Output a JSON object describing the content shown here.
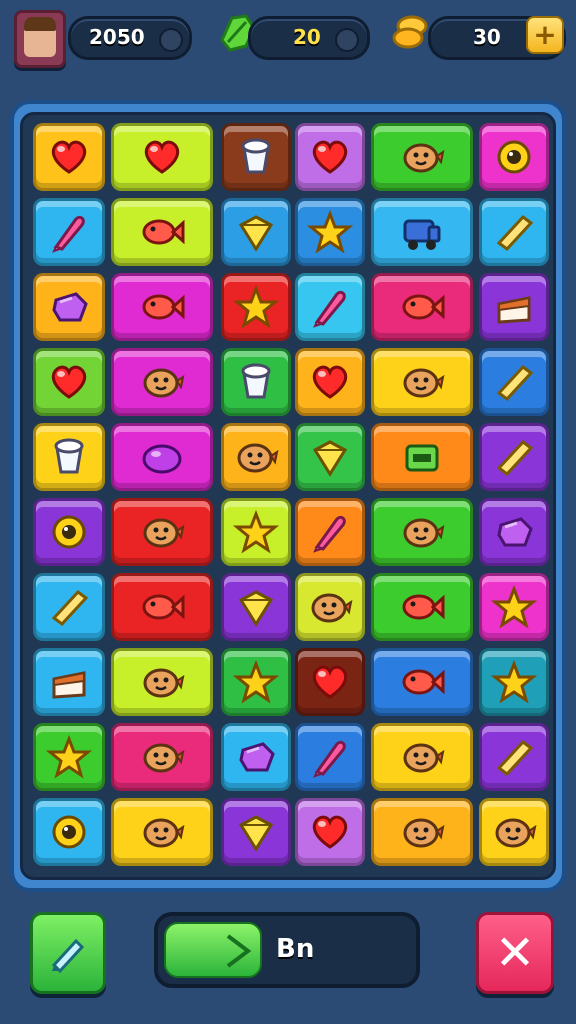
{
  "hud": {
    "lives_value": "2050",
    "leaves_value": "20",
    "coins_value": "30",
    "plus_label": "+"
  },
  "board": {
    "rows": [
      [
        {
          "color": "#ffc21a",
          "icon": "heart"
        },
        {
          "color": "#c8f02a",
          "icon": "heart"
        },
        {
          "color": "#8a3b1c",
          "icon": "cup"
        },
        {
          "color": "#c06ee8",
          "icon": "heart"
        },
        {
          "color": "#3dcc2e",
          "icon": "face"
        },
        {
          "color": "#ee33cc",
          "icon": "flower"
        }
      ],
      [
        {
          "color": "#2fb5ef",
          "icon": "drop"
        },
        {
          "color": "#c8f02a",
          "icon": "fish"
        },
        {
          "color": "#2b9ee6",
          "icon": "diamond"
        },
        {
          "color": "#2b8ee0",
          "icon": "star"
        },
        {
          "color": "#35b8f2",
          "icon": "truck"
        },
        {
          "color": "#2fb5ef",
          "icon": "stick"
        }
      ],
      [
        {
          "color": "#ffb31a",
          "icon": "gem"
        },
        {
          "color": "#e02ad2",
          "icon": "fish"
        },
        {
          "color": "#ea2424",
          "icon": "star"
        },
        {
          "color": "#36c6ef",
          "icon": "drop"
        },
        {
          "color": "#ea2a7a",
          "icon": "fish"
        },
        {
          "color": "#8a35d8",
          "icon": "cake"
        }
      ],
      [
        {
          "color": "#72d435",
          "icon": "heart"
        },
        {
          "color": "#e02ad2",
          "icon": "face"
        },
        {
          "color": "#2fbf45",
          "icon": "cup"
        },
        {
          "color": "#ffb31a",
          "icon": "heart"
        },
        {
          "color": "#ffd21a",
          "icon": "face"
        },
        {
          "color": "#2b7ee0",
          "icon": "stick"
        }
      ],
      [
        {
          "color": "#ffd21a",
          "icon": "cup"
        },
        {
          "color": "#e02ad2",
          "icon": "blob"
        },
        {
          "color": "#ffb31a",
          "icon": "face"
        },
        {
          "color": "#35c44a",
          "icon": "diamond"
        },
        {
          "color": "#ff8a1a",
          "icon": "box"
        },
        {
          "color": "#8a35d8",
          "icon": "stick"
        }
      ],
      [
        {
          "color": "#8a35d8",
          "icon": "flower"
        },
        {
          "color": "#ea2424",
          "icon": "face"
        },
        {
          "color": "#c8f02a",
          "icon": "star"
        },
        {
          "color": "#ff8a1a",
          "icon": "drop"
        },
        {
          "color": "#3dcc2e",
          "icon": "face"
        },
        {
          "color": "#8a35d8",
          "icon": "gem"
        }
      ],
      [
        {
          "color": "#2fb5ef",
          "icon": "stick"
        },
        {
          "color": "#ea2424",
          "icon": "fish"
        },
        {
          "color": "#8a35d8",
          "icon": "diamond"
        },
        {
          "color": "#d8e830",
          "icon": "face"
        },
        {
          "color": "#3dcc2e",
          "icon": "fish"
        },
        {
          "color": "#ee33cc",
          "icon": "star"
        }
      ],
      [
        {
          "color": "#2fb5ef",
          "icon": "cake"
        },
        {
          "color": "#c8f02a",
          "icon": "face"
        },
        {
          "color": "#2fbf45",
          "icon": "star"
        },
        {
          "color": "#7a2414",
          "icon": "heart"
        },
        {
          "color": "#2b7ee0",
          "icon": "fish"
        },
        {
          "color": "#1fa0b8",
          "icon": "star"
        }
      ],
      [
        {
          "color": "#3dcc2e",
          "icon": "star"
        },
        {
          "color": "#ea2a7a",
          "icon": "face"
        },
        {
          "color": "#2fb5ef",
          "icon": "gem"
        },
        {
          "color": "#2b7ee0",
          "icon": "drop"
        },
        {
          "color": "#ffd21a",
          "icon": "face"
        },
        {
          "color": "#8a35d8",
          "icon": "stick"
        }
      ],
      [
        {
          "color": "#2fb5ef",
          "icon": "flower"
        },
        {
          "color": "#ffd21a",
          "icon": "face"
        },
        {
          "color": "#8a35d8",
          "icon": "diamond"
        },
        {
          "color": "#c06ee8",
          "icon": "heart"
        },
        {
          "color": "#ffb31a",
          "icon": "face"
        },
        {
          "color": "#ffd21a",
          "icon": "face"
        }
      ]
    ]
  },
  "bottom": {
    "progress_label": "Bn",
    "progress_fraction": 0.4,
    "close_label": "✕"
  },
  "colors": {
    "accent_green": "#2cb43a",
    "accent_red": "#e5285b",
    "gold": "#f4b51f"
  }
}
